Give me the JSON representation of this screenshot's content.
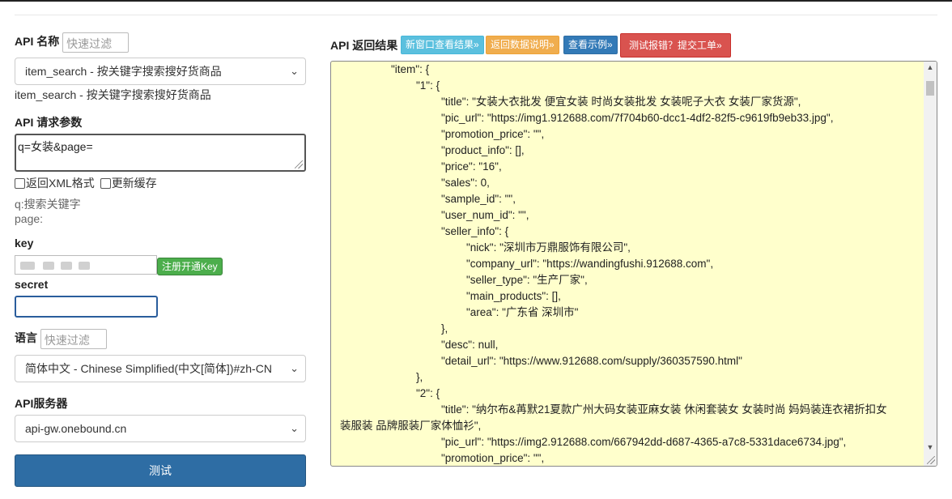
{
  "api_name": {
    "label": "API 名称",
    "filter_placeholder": "快速过滤",
    "selected": "item_search - 按关键字搜索搜好货商品",
    "description": "item_search - 按关键字搜索搜好货商品"
  },
  "params": {
    "label": "API 请求参数",
    "value": "q=女装&page=",
    "xml_label": "返回XML格式",
    "cache_label": "更新缓存",
    "hint_q": "q:搜索关键字",
    "hint_page": "page:"
  },
  "key": {
    "label": "key",
    "register_label": "注册开通Key"
  },
  "secret": {
    "label": "secret"
  },
  "language": {
    "label": "语言",
    "filter_placeholder": "快速过滤",
    "selected": "简体中文 - Chinese Simplified(中文[简体])#zh-CN"
  },
  "server": {
    "label": "API服务器",
    "selected": "api-gw.onebound.cn"
  },
  "test_button": "测试",
  "result": {
    "label": "API 返回结果",
    "btn_new_window": "新窗口查看结果»",
    "btn_data_desc": "返回数据说明»",
    "btn_example": "查看示例»",
    "btn_report": "测试报错？提交工单»",
    "lines": [
      {
        "t": "\"item\": {",
        "i": 1
      },
      {
        "t": "\"1\": {",
        "i": 2
      },
      {
        "t": "\"title\": \"女装大衣批发 便宜女装 时尚女装批发 女装呢子大衣 女装厂家货源\",",
        "i": 3
      },
      {
        "t": "\"pic_url\": \"https://img1.912688.com/7f704b60-dcc1-4df2-82f5-c9619fb9eb33.jpg\",",
        "i": 3
      },
      {
        "t": "\"promotion_price\": \"\",",
        "i": 3
      },
      {
        "t": "\"product_info\": [],",
        "i": 3
      },
      {
        "t": "\"price\": \"16\",",
        "i": 3
      },
      {
        "t": "\"sales\": 0,",
        "i": 3
      },
      {
        "t": "\"sample_id\": \"\",",
        "i": 3
      },
      {
        "t": "\"user_num_id\": \"\",",
        "i": 3
      },
      {
        "t": "\"seller_info\": {",
        "i": 3
      },
      {
        "t": "\"nick\": \"深圳市万鼎服饰有限公司\",",
        "i": 4
      },
      {
        "t": "\"company_url\": \"https://wandingfushi.912688.com\",",
        "i": 4
      },
      {
        "t": "\"seller_type\": \"生产厂家\",",
        "i": 4
      },
      {
        "t": "\"main_products\": [],",
        "i": 4
      },
      {
        "t": "\"area\": \"广东省 深圳市\"",
        "i": 4
      },
      {
        "t": "},",
        "i": 3
      },
      {
        "t": "\"desc\": null,",
        "i": 3
      },
      {
        "t": "\"detail_url\": \"https://www.912688.com/supply/360357590.html\"",
        "i": 3
      },
      {
        "t": "},",
        "i": 2
      },
      {
        "t": "\"2\": {",
        "i": 2
      },
      {
        "t": "\"title\": \"纳尔布&苒默21夏款广州大码女装亚麻女装 休闲套装女 女装时尚 妈妈装连衣裙折扣女",
        "i": 3
      },
      {
        "t": "装服装 品牌服装厂家体恤衫\",",
        "i": 0
      },
      {
        "t": "\"pic_url\": \"https://img2.912688.com/667942dd-d687-4365-a7c8-5331dace6734.jpg\",",
        "i": 3
      },
      {
        "t": "\"promotion_price\": \"\",",
        "i": 3
      }
    ]
  }
}
